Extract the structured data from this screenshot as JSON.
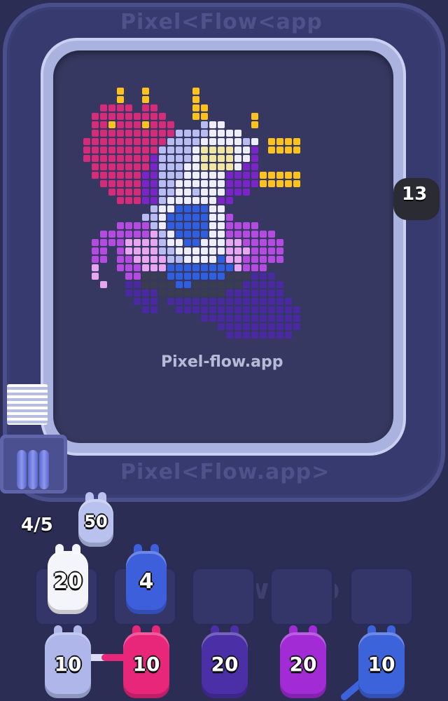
{
  "watermarks": {
    "top_banner": "Pixel<Flow<app",
    "bottom_banner": "Pixel<Flow.app>",
    "board_label": "Pixel-flow.app",
    "slots_faint": "Flow.app"
  },
  "conveyor_critter": {
    "count": "13",
    "color": "#2a2b33"
  },
  "queue": {
    "position_label": "4/5",
    "next_shooter": {
      "count": "50",
      "color": "#b9c1ee"
    }
  },
  "slots": [
    {
      "count": "20",
      "color": "#f4f4fb",
      "filled": true
    },
    {
      "count": "4",
      "color": "#3d5fdc",
      "filled": true
    },
    {
      "count": "",
      "filled": false
    },
    {
      "count": "",
      "filled": false
    },
    {
      "count": "",
      "filled": false
    }
  ],
  "shooters": [
    {
      "count": "10",
      "color": "#aeb6ea"
    },
    {
      "count": "10",
      "color": "#e8267a"
    },
    {
      "count": "20",
      "color": "#4b2fa6"
    },
    {
      "count": "20",
      "color": "#a22bd6"
    },
    {
      "count": "10",
      "color": "#3d63db"
    }
  ],
  "palette": {
    "M": "#d72a79",
    "Y": "#ffc21a",
    "V": "#7b24c9",
    "P": "#b54ae0",
    "L": "#e8a6f0",
    "W": "#eeeefa",
    "G": "#b7bdf0",
    "S": "#f0e6a0",
    "B": "#2f5fe0",
    "D": "#4a2aa0",
    "K": "#3a3d50"
  },
  "pixel_art": [
    "..............................",
    ".....Y..Y.....Y...............",
    ".....Y..Y.....Y...............",
    "...MMMM.MM....YY..............",
    "..MMMMMMMMM...YY.....Y........",
    "..MMYMMMYMMM...GWW...Y........",
    "..MMMMMMMMMMGGGGWWWW..........",
    ".MMMMMMMMMMGGGGWWWWWGW.YYYY...",
    ".MMMMMMMMMGGGGWSSSSWWV.YYYY...",
    ".MMMMMMMMVGGGGWSSSSWWV........",
    "..MMMMMMMVGGGWWSSSSWVV........",
    "..MMMMMMVVGGGWWWWWVVVVYYYYY...",
    "...MMMMMVVGGWWWWWWVVVVYYYYY...",
    "....MMMMVVGGWWGWWWVVV.........",
    ".....MMMVVGWWWWWWVV...........",
    ".........GWWBBBBWW............",
    "........GGWBBBBBWWP...........",
    ".....PPPPGWBBBBBWWPPPP........",
    "...PPPPPPLGWBBBBWWPPPPPP......",
    "..PPPPLLLLGWWBBWWWLLPPPPP.....",
    "..PP.PLLLLGGWWWWWWLLLPPPP.....",
    "..PP.PPLLLLGGWWWWBLLPPPPP.....",
    "..L..PPPLLLBBBBBBBBLPPP.......",
    "..L...PPKKKBBBBBBBKKKDDD......",
    "...L..DDKKKKBBKKKKKKDDDDD.....",
    "......DDDDKKKKKKKKDDDDDDD.....",
    ".......DDD.DDDDDDDDDDDDDDD....",
    "........DD..DDDDDDDDDDDDDDD...",
    "...............DDDDDDDDDDDD...",
    ".................DDDDDDDDDD...",
    "..................DDDDDDDD...."
  ]
}
